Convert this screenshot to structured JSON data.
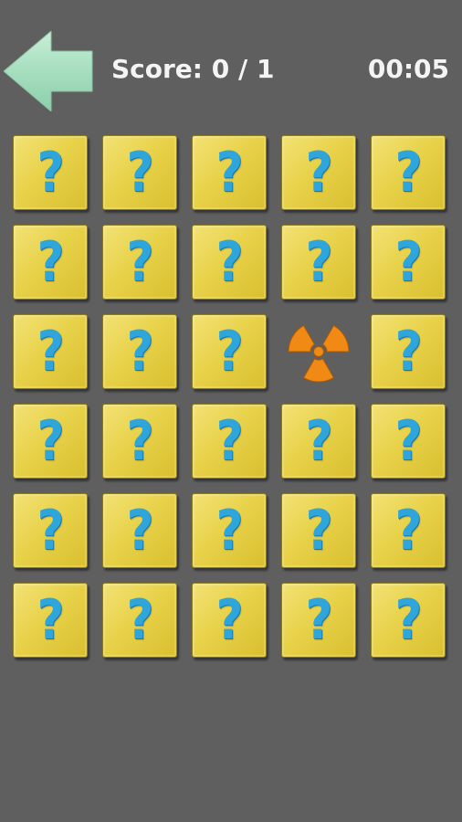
{
  "header": {
    "back_icon": "back-arrow-icon",
    "score_text": "Score: 0 / 1",
    "timer_text": "00:05"
  },
  "colors": {
    "background": "#5f5f5f",
    "tile": "#e8d24a",
    "question_mark": "#2ea6dc",
    "hazard_symbol": "#f08a14",
    "back_arrow": "#a8e0c0",
    "text": "#f4f4f4"
  },
  "board": {
    "rows": 6,
    "columns": 5,
    "hidden_glyph": "?",
    "hidden_icon": "question-mark-icon",
    "revealed_icon": "radiation-hazard-icon",
    "tiles": [
      "hidden",
      "hidden",
      "hidden",
      "hidden",
      "hidden",
      "hidden",
      "hidden",
      "hidden",
      "hidden",
      "hidden",
      "hidden",
      "hidden",
      "hidden",
      "revealed",
      "hidden",
      "hidden",
      "hidden",
      "hidden",
      "hidden",
      "hidden",
      "hidden",
      "hidden",
      "hidden",
      "hidden",
      "hidden",
      "hidden",
      "hidden",
      "hidden",
      "hidden",
      "hidden"
    ]
  }
}
